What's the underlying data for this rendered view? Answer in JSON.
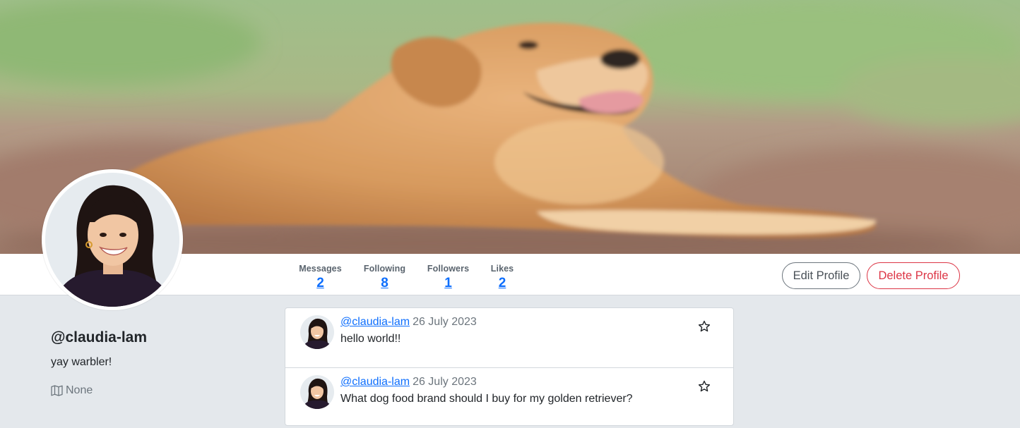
{
  "profile": {
    "username": "@claudia-lam",
    "bio": "yay warbler!",
    "location": "None",
    "header_image": "golden retriever lying on dirt path",
    "avatar_image": "woman smiling, dark top"
  },
  "stats": [
    {
      "label": "Messages",
      "value": "2"
    },
    {
      "label": "Following",
      "value": "8"
    },
    {
      "label": "Followers",
      "value": "1"
    },
    {
      "label": "Likes",
      "value": "2"
    }
  ],
  "actions": {
    "edit_label": "Edit Profile",
    "delete_label": "Delete Profile"
  },
  "messages": [
    {
      "user": "@claudia-lam",
      "date": "26 July 2023",
      "text": "hello world!!",
      "icon": "star-outline-icon"
    },
    {
      "user": "@claudia-lam",
      "date": "26 July 2023",
      "text": "What dog food brand should I buy for my golden retriever?",
      "icon": "star-outline-icon"
    }
  ],
  "colors": {
    "link": "#0d6efd",
    "danger": "#dc3545",
    "background": "#e4e8ec"
  }
}
